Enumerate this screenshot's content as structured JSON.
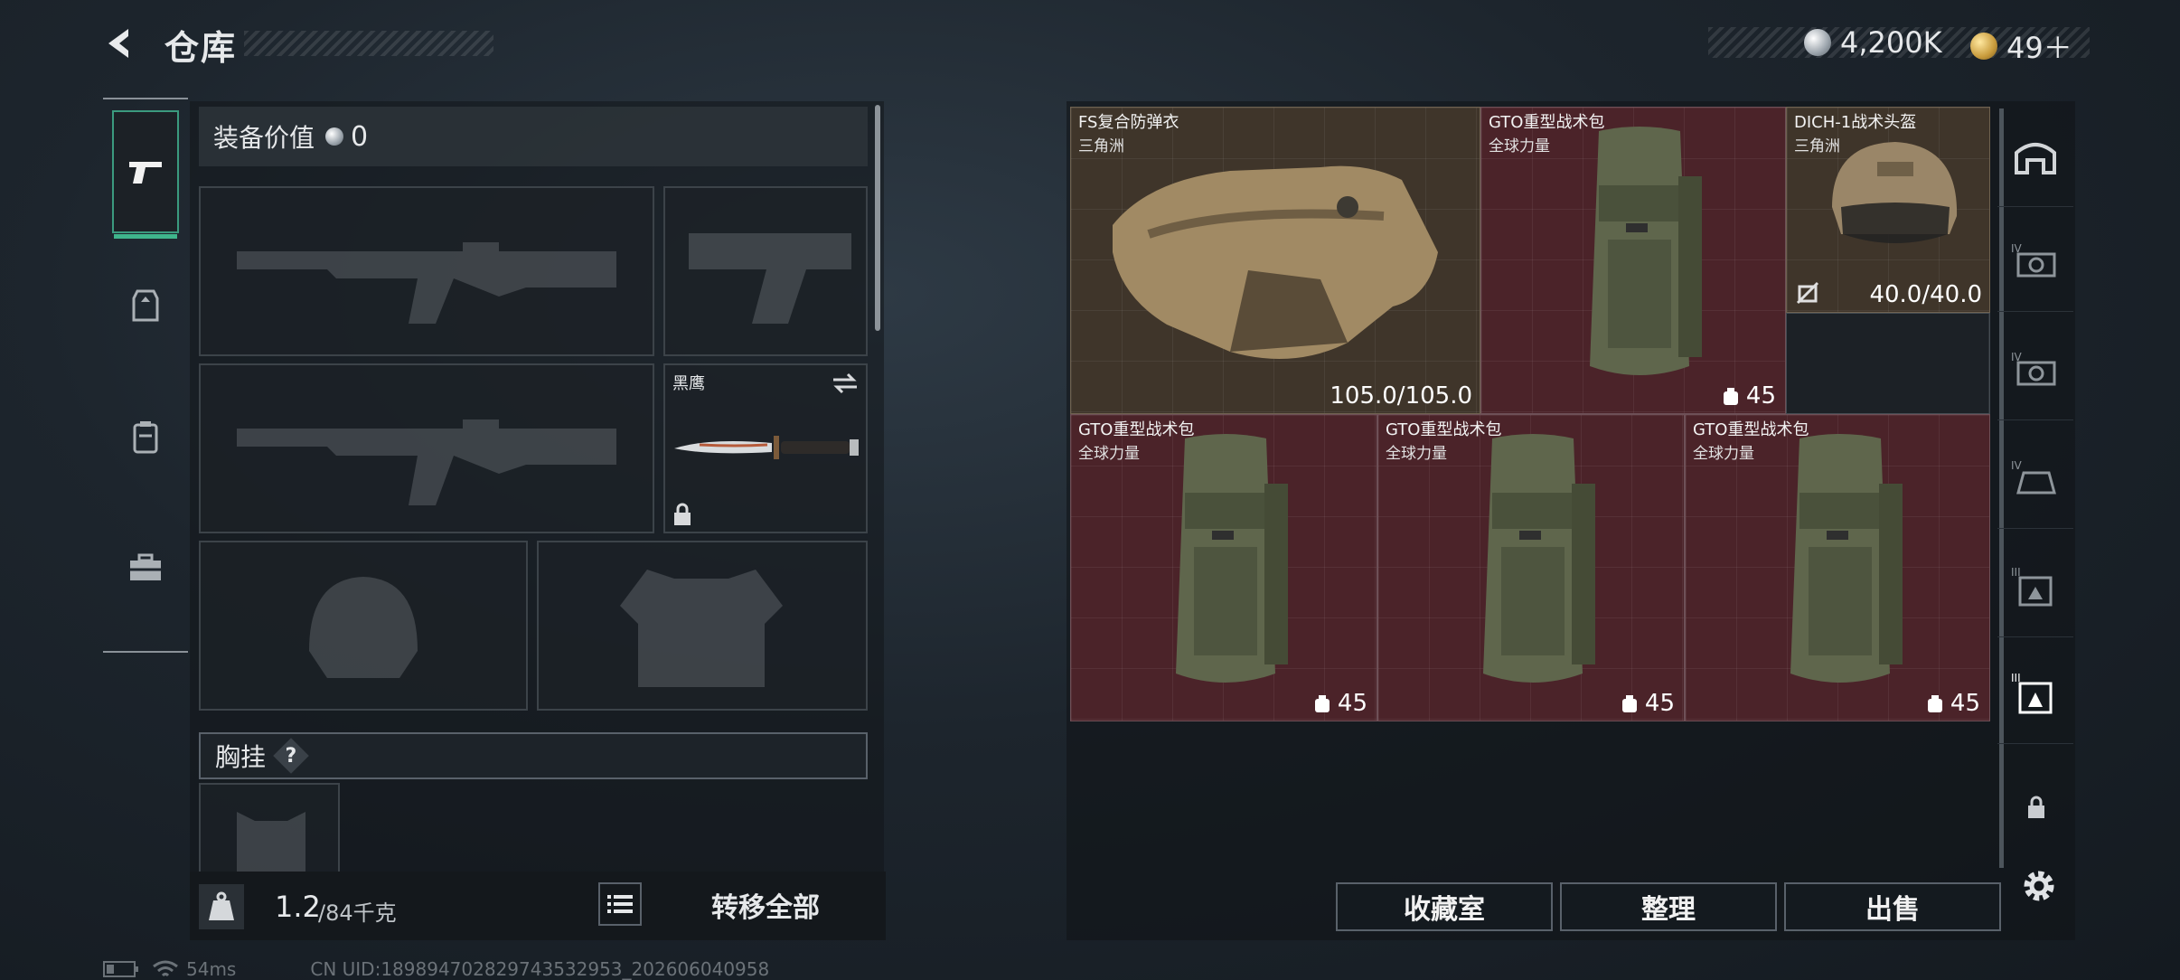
{
  "header": {
    "title": "仓库",
    "currency_silver": "4,200K",
    "currency_gold": "49＋"
  },
  "left_tabs": [
    {
      "icon": "pistol-icon",
      "active": true
    },
    {
      "icon": "helmet-armor-icon",
      "active": false
    },
    {
      "icon": "backpack-icon",
      "active": false
    },
    {
      "icon": "toolbox-icon",
      "active": false
    }
  ],
  "equipment": {
    "value_label": "装备价值",
    "value": "0",
    "knife_name": "黑鹰",
    "chest_label": "胸挂",
    "chest_help": "?",
    "weight_value": "1.2",
    "weight_capacity": "/84千克",
    "transfer_all": "转移全部"
  },
  "stash": {
    "items": [
      {
        "name": "FS复合防弹衣",
        "sub": "三角洲",
        "stat": "105.0/105.0"
      },
      {
        "name": "GTO重型战术包",
        "sub": "全球力量",
        "stat": "45"
      },
      {
        "name": "DICH-1战术头盔",
        "sub": "三角洲",
        "stat": "40.0/40.0"
      },
      {
        "name": "GTO重型战术包",
        "sub": "全球力量",
        "stat": "45"
      },
      {
        "name": "GTO重型战术包",
        "sub": "全球力量",
        "stat": "45"
      },
      {
        "name": "GTO重型战术包",
        "sub": "全球力量",
        "stat": "45"
      }
    ],
    "buttons": {
      "collection": "收藏室",
      "organize": "整理",
      "sell": "出售"
    }
  },
  "right_tabs": [
    {
      "icon": "safe-house-icon"
    },
    {
      "icon": "level-iv-armor-filter-icon",
      "label": "IV"
    },
    {
      "icon": "level-iv-helmet-filter-icon",
      "label": "IV"
    },
    {
      "icon": "level-iv-rig-filter-icon",
      "label": "IV"
    },
    {
      "icon": "level-iii-bag-filter-icon",
      "label": "III"
    },
    {
      "icon": "level-iii-bag-filter-active-icon",
      "label": "III"
    },
    {
      "icon": "lock-icon"
    }
  ],
  "status": {
    "ping": "54ms",
    "uid": "CN UID:189894702829743532953_202606040958"
  },
  "colors": {
    "accent_green": "#3fb58c",
    "item_red": "#4b2329",
    "item_brown": "#3f352a"
  }
}
